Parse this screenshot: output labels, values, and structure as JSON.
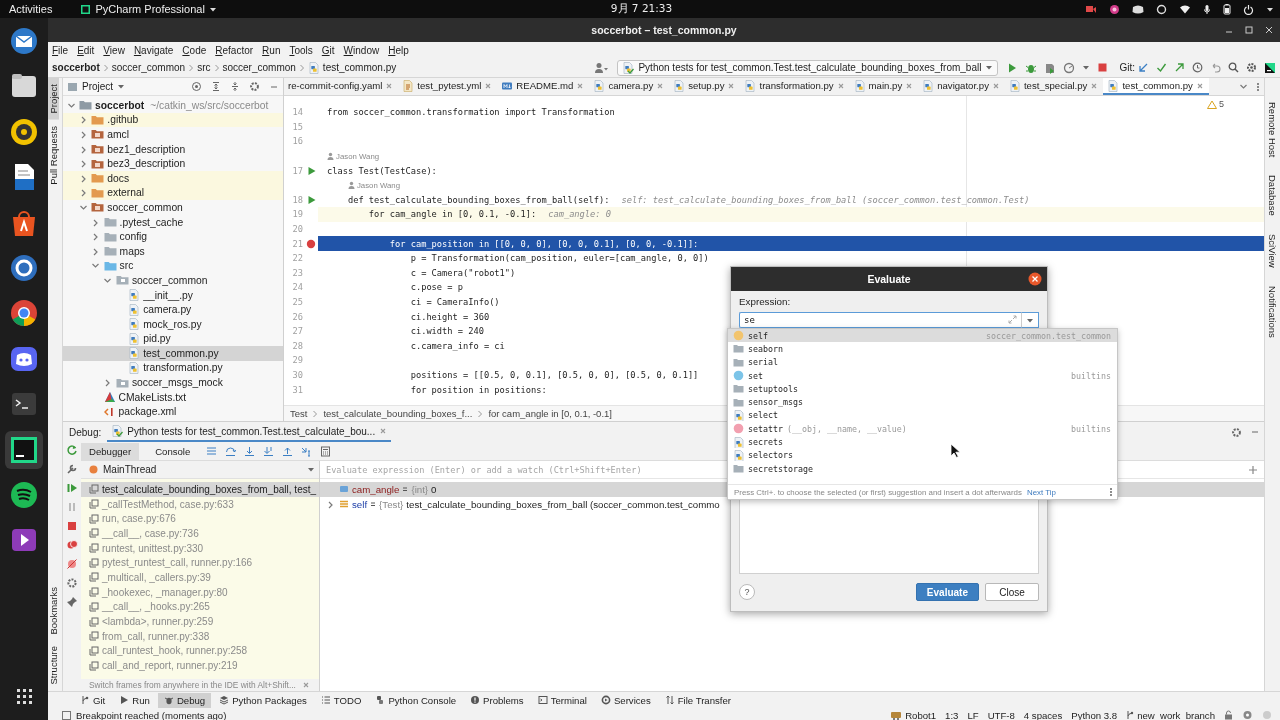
{
  "desktop_bar": {
    "activities": "Activities",
    "app_menu": "PyCharm Professional",
    "clock": "9月 7 21:33"
  },
  "dock": [
    {
      "kind": "mail",
      "active": false
    },
    {
      "kind": "files",
      "active": false
    },
    {
      "kind": "disc",
      "active": false
    },
    {
      "kind": "writer",
      "active": false
    },
    {
      "kind": "store",
      "active": false
    },
    {
      "kind": "help",
      "active": false
    },
    {
      "kind": "browser",
      "active": false
    },
    {
      "kind": "chat",
      "active": false
    },
    {
      "kind": "terminal",
      "active": false
    },
    {
      "kind": "ide",
      "active": true
    },
    {
      "kind": "audio",
      "active": false
    },
    {
      "kind": "video",
      "active": false
    },
    {
      "kind": "apps",
      "active": false
    }
  ],
  "window": {
    "title": "soccerbot – test_common.py"
  },
  "menu": [
    "File",
    "Edit",
    "View",
    "Navigate",
    "Code",
    "Refactor",
    "Run",
    "Tools",
    "Git",
    "Window",
    "Help"
  ],
  "navigation_bar": {
    "breadcrumbs": [
      "soccerbot",
      "soccer_common",
      "src",
      "soccer_common",
      "test_common.py"
    ],
    "run_configuration": "Python tests for test_common.Test.test_calculate_bounding_boxes_from_ball",
    "vcs_label": "Git:"
  },
  "left_strip": {
    "top": [
      {
        "label": "Project",
        "selected": true
      },
      {
        "label": "Pull Requests",
        "selected": false
      }
    ],
    "bottom": [
      "Bookmarks",
      "Structure"
    ]
  },
  "right_strip": [
    "Remote Host",
    "Database",
    "SciView",
    "Notifications"
  ],
  "project": {
    "title": "Project",
    "tree": [
      {
        "name": "soccerbot",
        "path": "~/catkin_ws/src/soccerbot",
        "kind": "root",
        "expanded": true,
        "selected": false,
        "ignored": false,
        "children": [
          {
            "name": ".github",
            "kind": "folder",
            "expanded": false,
            "selected": false,
            "ignored": true
          },
          {
            "name": "amcl",
            "kind": "package",
            "expanded": false,
            "selected": false,
            "ignored": false
          },
          {
            "name": "bez1_description",
            "kind": "package",
            "expanded": false,
            "selected": false,
            "ignored": false
          },
          {
            "name": "bez3_description",
            "kind": "package",
            "expanded": false,
            "selected": false,
            "ignored": false
          },
          {
            "name": "docs",
            "kind": "folder",
            "expanded": false,
            "selected": false,
            "ignored": true
          },
          {
            "name": "external",
            "kind": "folder",
            "expanded": false,
            "selected": false,
            "ignored": true
          },
          {
            "name": "soccer_common",
            "kind": "package",
            "expanded": true,
            "selected": false,
            "ignored": false,
            "children": [
              {
                "name": ".pytest_cache",
                "kind": "folder",
                "expanded": false,
                "selected": false,
                "ignored": false
              },
              {
                "name": "config",
                "kind": "folder",
                "expanded": false,
                "selected": false,
                "ignored": false
              },
              {
                "name": "maps",
                "kind": "folder",
                "expanded": false,
                "selected": false,
                "ignored": false
              },
              {
                "name": "src",
                "kind": "source",
                "expanded": true,
                "selected": false,
                "ignored": false,
                "children": [
                  {
                    "name": "soccer_common",
                    "kind": "module",
                    "expanded": true,
                    "selected": false,
                    "ignored": false,
                    "children": [
                      {
                        "name": "__init__.py",
                        "kind": "python",
                        "selected": false,
                        "ignored": false
                      },
                      {
                        "name": "camera.py",
                        "kind": "python",
                        "selected": false,
                        "ignored": false
                      },
                      {
                        "name": "mock_ros.py",
                        "kind": "python",
                        "selected": false,
                        "ignored": false
                      },
                      {
                        "name": "pid.py",
                        "kind": "python",
                        "selected": false,
                        "ignored": false
                      },
                      {
                        "name": "test_common.py",
                        "kind": "python",
                        "selected": true,
                        "ignored": false
                      },
                      {
                        "name": "transformation.py",
                        "kind": "python",
                        "selected": false,
                        "ignored": false
                      }
                    ]
                  },
                  {
                    "name": "soccer_msgs_mock",
                    "kind": "module",
                    "expanded": false,
                    "selected": false,
                    "ignored": false
                  }
                ]
              },
              {
                "name": "CMakeLists.txt",
                "kind": "cmake",
                "selected": false,
                "ignored": false
              },
              {
                "name": "package.xml",
                "kind": "xml",
                "selected": false,
                "ignored": false
              }
            ]
          }
        ]
      }
    ]
  },
  "editor": {
    "tabs": [
      {
        "label": "re-commit-config.yaml",
        "selected": false
      },
      {
        "label": "test_pytest.yml",
        "kind": "yaml",
        "selected": false
      },
      {
        "label": "README.md",
        "kind": "markdown",
        "selected": false
      },
      {
        "label": "camera.py",
        "kind": "python",
        "selected": false
      },
      {
        "label": "setup.py",
        "kind": "python",
        "selected": false
      },
      {
        "label": "transformation.py",
        "kind": "python",
        "selected": false
      },
      {
        "label": "main.py",
        "kind": "python",
        "selected": false
      },
      {
        "label": "navigator.py",
        "kind": "python",
        "selected": false
      },
      {
        "label": "test_special.py",
        "kind": "python",
        "selected": false
      },
      {
        "label": "test_common.py",
        "kind": "python",
        "selected": true
      }
    ],
    "warning_count": "5",
    "lines": [
      {
        "kind": "code",
        "number": "14",
        "text": "from soccer_common.transformation import Transformation",
        "run_marker": false,
        "breakpoint": false,
        "execution_point": false,
        "caret_line": false
      },
      {
        "kind": "code",
        "number": "15",
        "run_marker": false,
        "breakpoint": false,
        "execution_point": false,
        "caret_line": false
      },
      {
        "kind": "code",
        "number": "16",
        "run_marker": false,
        "breakpoint": false,
        "execution_point": false,
        "caret_line": false
      },
      {
        "kind": "author",
        "text": "Jason Wang"
      },
      {
        "kind": "code",
        "number": "17",
        "text": "class Test(TestCase):",
        "run_marker": true,
        "breakpoint": false,
        "execution_point": false,
        "caret_line": false
      },
      {
        "kind": "author",
        "text": "Jason Wang"
      },
      {
        "kind": "code",
        "number": "18",
        "text": "    def test_calculate_bounding_boxes_from_ball(self):",
        "hint": "self: test_calculate_bounding_boxes_from_ball (soccer_common.test_common.Test)",
        "run_marker": true,
        "breakpoint": false,
        "execution_point": false,
        "caret_line": false
      },
      {
        "kind": "code",
        "number": "19",
        "text": "        for cam_angle in [0, 0.1, -0.1]:",
        "hint": "cam_angle: 0",
        "run_marker": false,
        "breakpoint": false,
        "execution_point": false,
        "caret_line": true
      },
      {
        "kind": "code",
        "number": "20",
        "run_marker": false,
        "breakpoint": false,
        "execution_point": false,
        "caret_line": false
      },
      {
        "kind": "code",
        "number": "21",
        "text": "            for cam_position in [[0, 0, 0], [0, 0, 0.1], [0, 0, -0.1]]:",
        "run_marker": false,
        "breakpoint": true,
        "execution_point": true,
        "caret_line": false
      },
      {
        "kind": "code",
        "number": "22",
        "text": "                p = Transformation(cam_position, euler=[cam_angle, 0, 0])",
        "run_marker": false,
        "breakpoint": false,
        "execution_point": false,
        "caret_line": false
      },
      {
        "kind": "code",
        "number": "23",
        "text": "                c = Camera(\"robot1\")",
        "run_marker": false,
        "breakpoint": false,
        "execution_point": false,
        "caret_line": false
      },
      {
        "kind": "code",
        "number": "24",
        "text": "                c.pose = p",
        "run_marker": false,
        "breakpoint": false,
        "execution_point": false,
        "caret_line": false
      },
      {
        "kind": "code",
        "number": "25",
        "text": "                ci = CameraInfo()",
        "run_marker": false,
        "breakpoint": false,
        "execution_point": false,
        "caret_line": false
      },
      {
        "kind": "code",
        "number": "26",
        "text": "                ci.height = 360",
        "run_marker": false,
        "breakpoint": false,
        "execution_point": false,
        "caret_line": false
      },
      {
        "kind": "code",
        "number": "27",
        "text": "                ci.width = 240",
        "run_marker": false,
        "breakpoint": false,
        "execution_point": false,
        "caret_line": false
      },
      {
        "kind": "code",
        "number": "28",
        "text": "                c.camera_info = ci",
        "run_marker": false,
        "breakpoint": false,
        "execution_point": false,
        "caret_line": false
      },
      {
        "kind": "code",
        "number": "29",
        "run_marker": false,
        "breakpoint": false,
        "execution_point": false,
        "caret_line": false
      },
      {
        "kind": "code",
        "number": "30",
        "text": "                positions = [[0.5, 0, 0.1], [0.5, 0, 0], [0.5, 0, 0.1]]",
        "run_marker": false,
        "breakpoint": false,
        "execution_point": false,
        "caret_line": false
      },
      {
        "kind": "code",
        "number": "31",
        "text": "                for position in positions:",
        "run_marker": false,
        "breakpoint": false,
        "execution_point": false,
        "caret_line": false
      }
    ],
    "breadcrumbs": [
      "Test",
      "test_calculate_bounding_boxes_f...",
      "for cam_angle in [0, 0.1, -0.1]"
    ]
  },
  "debug": {
    "session_label": "Debug:",
    "session_tab": "Python tests for test_common.Test.test_calculate_bou...",
    "tabs": [
      {
        "label": "Debugger",
        "selected": true
      },
      {
        "label": "Console",
        "selected": false
      }
    ],
    "thread": "MainThread",
    "frames": [
      {
        "text": "test_calculate_bounding_boxes_from_ball, test_",
        "library": false,
        "selected": true
      },
      {
        "text": "_callTestMethod, case.py:633",
        "library": true,
        "selected": false
      },
      {
        "text": "run, case.py:676",
        "library": true,
        "selected": false
      },
      {
        "text": "__call__, case.py:736",
        "library": true,
        "selected": false
      },
      {
        "text": "runtest, unittest.py:330",
        "library": true,
        "selected": false
      },
      {
        "text": "pytest_runtest_call, runner.py:166",
        "library": true,
        "selected": false
      },
      {
        "text": "_multicall, _callers.py:39",
        "library": true,
        "selected": false
      },
      {
        "text": "_hookexec, _manager.py:80",
        "library": true,
        "selected": false
      },
      {
        "text": "__call__, _hooks.py:265",
        "library": true,
        "selected": false
      },
      {
        "text": "<lambda>, runner.py:259",
        "library": true,
        "selected": false
      },
      {
        "text": "from_call, runner.py:338",
        "library": true,
        "selected": false
      },
      {
        "text": "call_runtest_hook, runner.py:258",
        "library": true,
        "selected": false
      },
      {
        "text": "call_and_report, runner.py:219",
        "library": true,
        "selected": false
      }
    ],
    "frames_hint": "Switch frames from anywhere in the IDE with Alt+Shift...",
    "watch_placeholder": "Evaluate expression (Enter) or add a watch (Ctrl+Shift+Enter)",
    "variables": [
      {
        "kind": "int",
        "name": "cam_angle",
        "type": "{int}",
        "value": "0",
        "selected": true
      },
      {
        "kind": "object",
        "name": "self",
        "type": "{Test}",
        "value": "test_calculate_bounding_boxes_from_ball (soccer_common.test_commo",
        "selected": false,
        "expanded": false
      }
    ]
  },
  "evaluate": {
    "title": "Evaluate",
    "expression_label": "Expression:",
    "expression": "se",
    "completions": [
      {
        "kind": "parameter",
        "name": "self",
        "detail": "soccer_common.test_common",
        "selected": true
      },
      {
        "kind": "package",
        "name": "seaborn",
        "selected": false
      },
      {
        "kind": "package",
        "name": "serial",
        "selected": false
      },
      {
        "kind": "class",
        "name": "set",
        "detail": "builtins",
        "selected": false
      },
      {
        "kind": "package",
        "name": "setuptools",
        "selected": false
      },
      {
        "kind": "package",
        "name": "sensor_msgs",
        "selected": false
      },
      {
        "kind": "module",
        "name": "select",
        "selected": false
      },
      {
        "kind": "function",
        "name": "setattr",
        "params": "(__obj, __name, __value)",
        "detail": "builtins",
        "selected": false
      },
      {
        "kind": "module",
        "name": "secrets",
        "selected": false
      },
      {
        "kind": "module",
        "name": "selectors",
        "selected": false
      },
      {
        "kind": "package",
        "name": "secretstorage",
        "selected": false
      }
    ],
    "completion_hint": "Press Ctrl+. to choose the selected (or first) suggestion and insert a dot afterwards",
    "next_tip": "Next Tip",
    "help": "?",
    "buttons": [
      {
        "label": "Evaluate",
        "primary": true
      },
      {
        "label": "Close",
        "primary": false
      }
    ]
  },
  "tool_tabs": [
    {
      "label": "Git",
      "kind": "git",
      "selected": false
    },
    {
      "label": "Run",
      "kind": "run",
      "selected": false
    },
    {
      "label": "Debug",
      "kind": "debug",
      "selected": true
    },
    {
      "label": "Python Packages",
      "kind": "packages",
      "selected": false
    },
    {
      "label": "TODO",
      "kind": "todo",
      "selected": false
    },
    {
      "label": "Python Console",
      "kind": "console",
      "selected": false
    },
    {
      "label": "Problems",
      "kind": "problems",
      "selected": false
    },
    {
      "label": "Terminal",
      "kind": "terminal",
      "selected": false
    },
    {
      "label": "Services",
      "kind": "services",
      "selected": false
    },
    {
      "label": "File Transfer",
      "kind": "transfer",
      "selected": false
    }
  ],
  "status_bar": {
    "message": "Breakpoint reached (moments ago)",
    "interpreter_host": "Robot1",
    "items": [
      "1:3",
      "LF",
      "UTF-8",
      "4 spaces",
      "Python 3.8"
    ],
    "branch": "new_work_branch"
  }
}
